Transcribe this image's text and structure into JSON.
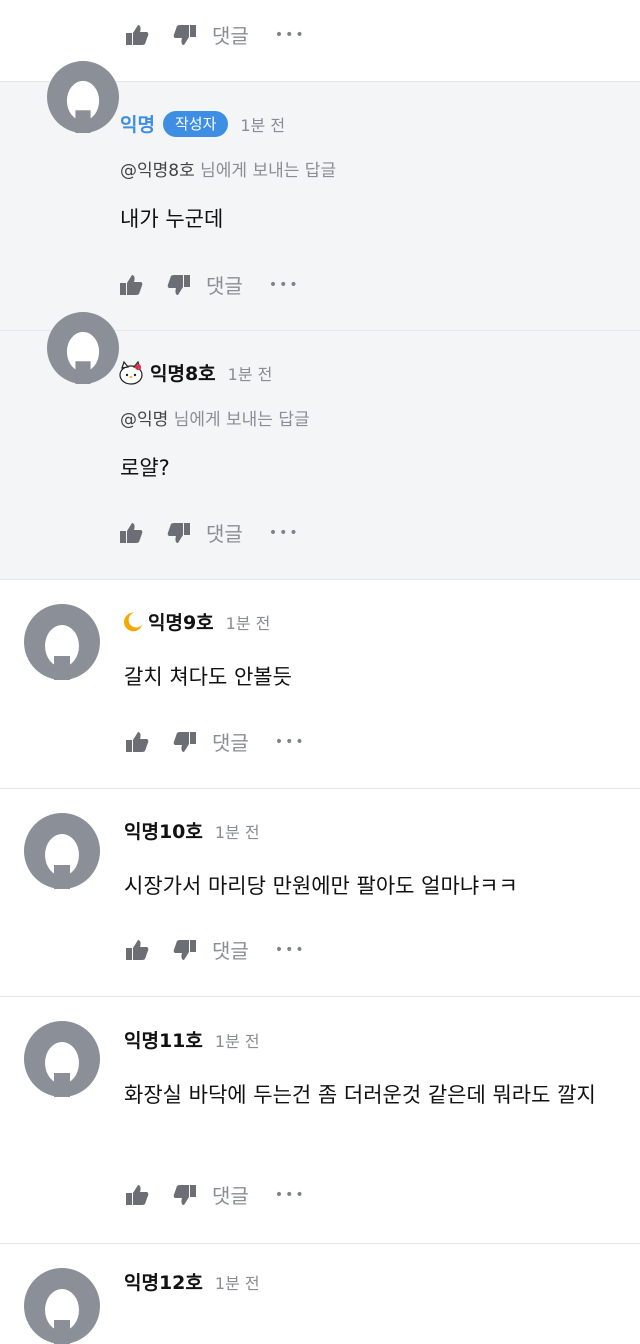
{
  "top_actions": {
    "reply_label": "댓글",
    "more": "•••"
  },
  "comments": [
    {
      "name": "익명",
      "badge": "작성자",
      "time": "1분 전",
      "mention_target": "@익명8호",
      "mention_suffix": "님에게 보내는 답글",
      "text": "내가 누군데",
      "reply_label": "댓글",
      "more": "•••"
    },
    {
      "name": "익명8호",
      "emblem": "hello-kitty-icon",
      "time": "1분 전",
      "mention_target": "@익명",
      "mention_suffix": "님에게 보내는 답글",
      "text": "로얄?",
      "reply_label": "댓글",
      "more": "•••"
    },
    {
      "name": "익명9호",
      "emblem": "moon-badge-icon",
      "time": "1분 전",
      "text": "갈치 쳐다도 안볼듯",
      "reply_label": "댓글",
      "more": "•••"
    },
    {
      "name": "익명10호",
      "time": "1분 전",
      "text": "시장가서 마리당 만원에만 팔아도 얼마냐ㅋㅋ",
      "reply_label": "댓글",
      "more": "•••"
    },
    {
      "name": "익명11호",
      "time": "1분 전",
      "text": "화장실 바닥에 두는건 좀 더러운것 같은데 뭐라도 깔지",
      "reply_label": "댓글",
      "more": "•••"
    },
    {
      "name": "익명12호",
      "time": "1분 전"
    }
  ],
  "colors": {
    "accent": "#3e8fe4",
    "reply_bg": "#f4f5f7",
    "divider": "#e4e6ea",
    "muted": "#8a8d93",
    "icon": "#6b6e74"
  }
}
